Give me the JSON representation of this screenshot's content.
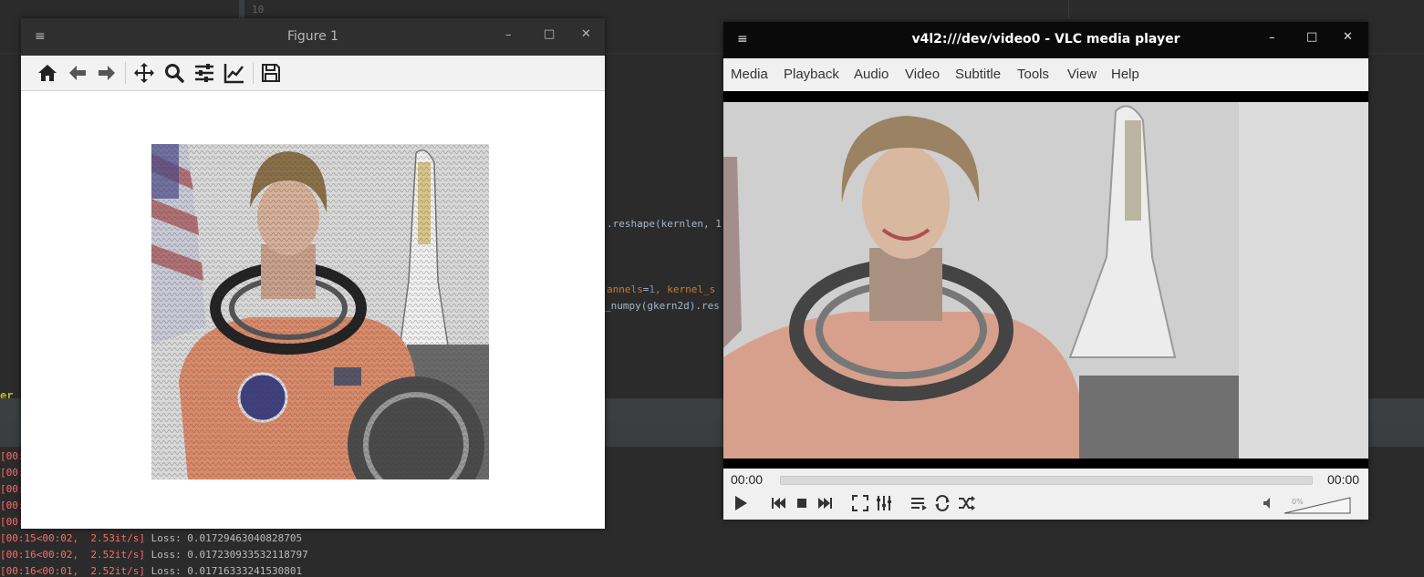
{
  "ide": {
    "line_number": "10",
    "code_lines": [
      {
        "text": ".reshape(kernlen, 1"
      },
      {
        "text_kw": "annels",
        "text_eq": "=",
        "text_num": "1",
        "text_rest": ", kernel_s"
      },
      {
        "text": "_numpy(gkern2d).res"
      }
    ],
    "left_word": "er",
    "console_lines": [
      {
        "red": "[00:",
        "txt": ""
      },
      {
        "red": "[00:",
        "txt": ""
      },
      {
        "red": "[00:",
        "txt": ""
      },
      {
        "red": "[00:",
        "txt": ""
      },
      {
        "red": "[00:",
        "txt": ""
      },
      {
        "red": "[00:15<00:02,  2.53it/s]",
        "txt": " Loss: 0.01729463040828705"
      },
      {
        "red": "[00:16<00:02,  2.52it/s]",
        "txt": " Loss: 0.017230933532118797"
      },
      {
        "red": "[00:16<00:01,  2.52it/s]",
        "txt": " Loss: 0.01716333241530801"
      }
    ]
  },
  "figure_window": {
    "title": "Figure 1",
    "menu_icon": "hamburger-icon",
    "toolbar": [
      "home-icon",
      "back-icon",
      "forward-icon",
      "pan-icon",
      "zoom-icon",
      "configure-icon",
      "edit-axis-icon",
      "save-icon"
    ]
  },
  "vlc_window": {
    "title": "v4l2:///dev/video0 - VLC media player",
    "menu": [
      "Media",
      "Playback",
      "Audio",
      "Video",
      "Subtitle",
      "Tools",
      "View",
      "Help"
    ],
    "time_elapsed": "00:00",
    "time_total": "00:00",
    "volume": "0%"
  }
}
